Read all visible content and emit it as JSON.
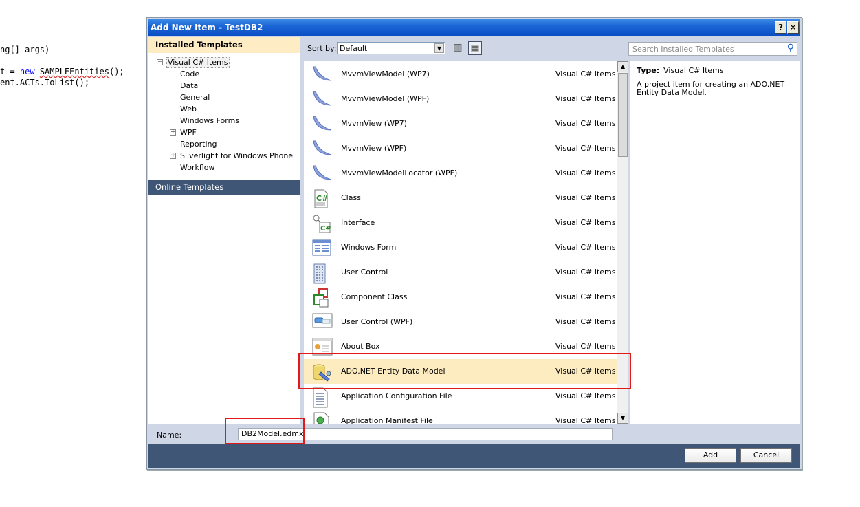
{
  "editor": {
    "line1": "ng[] args)",
    "line2_a": "t = ",
    "line2_kw": "new",
    "line2_b": " ",
    "line2_err": "SAMPLEEntities",
    "line2_c": "();",
    "line3": "ent.ACTs.ToList();"
  },
  "dialog": {
    "title": "Add New Item - TestDB2",
    "help_glyph": "?",
    "close_glyph": "✕"
  },
  "left": {
    "installed_header": "Installed Templates",
    "online_header": "Online Templates",
    "tree": [
      {
        "label": "Visual C# Items",
        "expander": "−"
      },
      {
        "label": "Code"
      },
      {
        "label": "Data"
      },
      {
        "label": "General"
      },
      {
        "label": "Web"
      },
      {
        "label": "Windows Forms"
      },
      {
        "label": "WPF",
        "expander": "+"
      },
      {
        "label": "Reporting"
      },
      {
        "label": "Silverlight for Windows Phone",
        "expander": "+"
      },
      {
        "label": "Workflow"
      }
    ]
  },
  "toolbar": {
    "sort_label": "Sort by:",
    "sort_value": "Default",
    "dropdown_arrow": "▼",
    "small_icons_glyph": "▥",
    "details_glyph": "▦"
  },
  "search": {
    "placeholder": "Search Installed Templates",
    "icon_glyph": "⚲"
  },
  "templates": [
    {
      "name": "MvvmViewModel (WP7)",
      "category": "Visual C# Items",
      "icon": "mvvm-icon"
    },
    {
      "name": "MvvmViewModel (WPF)",
      "category": "Visual C# Items",
      "icon": "mvvm-icon"
    },
    {
      "name": "MvvmView (WP7)",
      "category": "Visual C# Items",
      "icon": "mvvm-icon"
    },
    {
      "name": "MvvmView (WPF)",
      "category": "Visual C# Items",
      "icon": "mvvm-icon"
    },
    {
      "name": "MvvmViewModelLocator (WPF)",
      "category": "Visual C# Items",
      "icon": "mvvm-icon"
    },
    {
      "name": "Class",
      "category": "Visual C# Items",
      "icon": "class-icon"
    },
    {
      "name": "Interface",
      "category": "Visual C# Items",
      "icon": "interface-icon"
    },
    {
      "name": "Windows Form",
      "category": "Visual C# Items",
      "icon": "windows-form-icon"
    },
    {
      "name": "User Control",
      "category": "Visual C# Items",
      "icon": "user-control-icon"
    },
    {
      "name": "Component Class",
      "category": "Visual C# Items",
      "icon": "component-class-icon"
    },
    {
      "name": "User Control (WPF)",
      "category": "Visual C# Items",
      "icon": "user-control-wpf-icon"
    },
    {
      "name": "About Box",
      "category": "Visual C# Items",
      "icon": "about-box-icon"
    },
    {
      "name": "ADO.NET Entity Data Model",
      "category": "Visual C# Items",
      "icon": "entity-data-model-icon",
      "selected": true
    },
    {
      "name": "Application Configuration File",
      "category": "Visual C# Items",
      "icon": "config-file-icon"
    },
    {
      "name": "Application Manifest File",
      "category": "Visual C# Items",
      "icon": "manifest-file-icon"
    }
  ],
  "scrollbar": {
    "up_glyph": "▲",
    "down_glyph": "▼"
  },
  "detail": {
    "type_label": "Type:",
    "type_value": "Visual C# Items",
    "description": "A project item for creating an ADO.NET Entity Data Model."
  },
  "name_field": {
    "label": "Name:",
    "value": "DB2Model.edmx"
  },
  "buttons": {
    "add": "Add",
    "cancel": "Cancel"
  },
  "colors": {
    "title_bar": "#1c66d6",
    "selection": "#fdecc0",
    "footer": "#3f5676",
    "highlight_box": "#e11919"
  }
}
